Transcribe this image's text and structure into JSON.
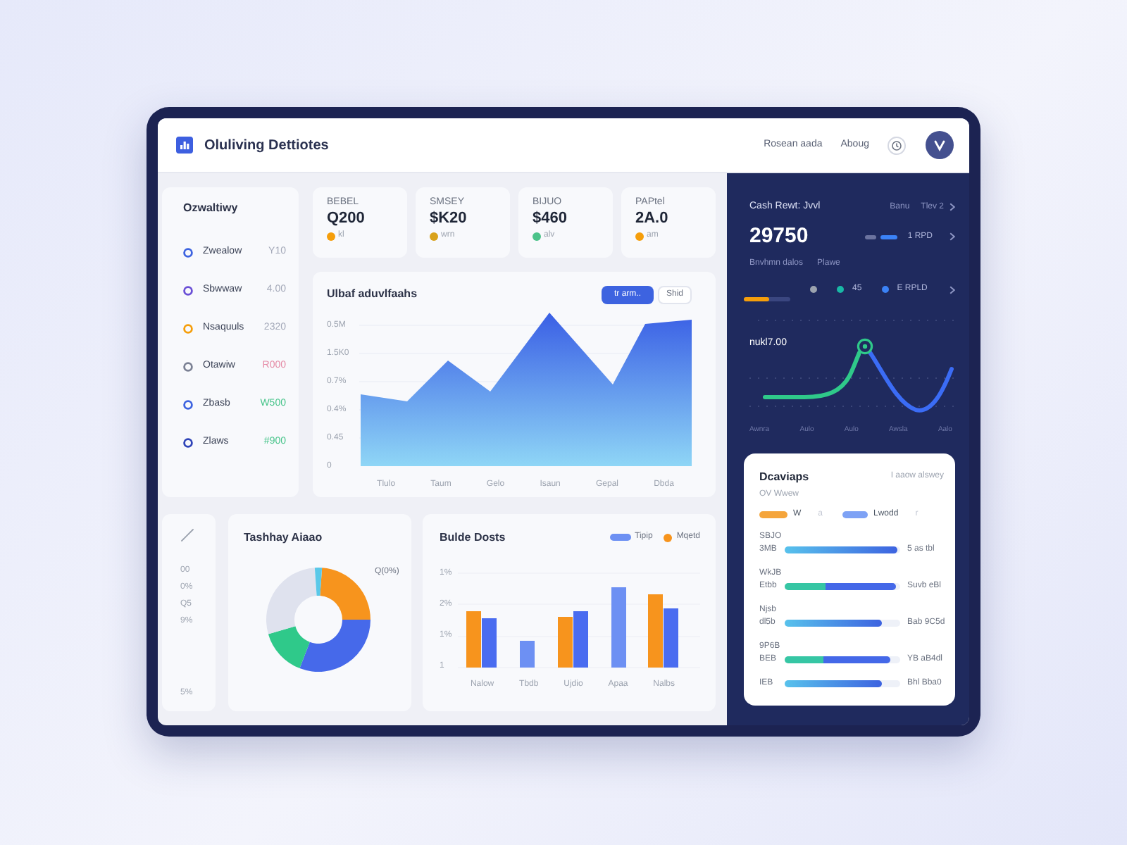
{
  "header": {
    "title": "Oluliving Dettiotes",
    "links": [
      "Rosean aada",
      "Aboug"
    ]
  },
  "sidebar": {
    "title": "Ozwaltiwy",
    "items": [
      {
        "label": "Zwealow",
        "value": "Y10",
        "color": "#3d63e0",
        "kind": "neutral"
      },
      {
        "label": "Sbwwaw",
        "value": "4.00",
        "color": "#6a4fd6",
        "kind": "neutral"
      },
      {
        "label": "Nsaquuls",
        "value": "2320",
        "color": "#f59e0b",
        "kind": "neutral"
      },
      {
        "label": "Otawiw",
        "value": "R000",
        "color": "#7b8194",
        "kind": "down"
      },
      {
        "label": "Zbasb",
        "value": "W500",
        "color": "#3d63e0",
        "kind": "up"
      },
      {
        "label": "Zlaws",
        "value": "#900",
        "color": "#2f44b8",
        "kind": "up"
      }
    ]
  },
  "stats": [
    {
      "label": "BEBEL",
      "value": "Q200",
      "change": "kl",
      "color": "#f59e0b"
    },
    {
      "label": "SMSEY",
      "value": "$K20",
      "change": "wrn",
      "color": "#d9a21b"
    },
    {
      "label": "BIJUO",
      "value": "$460",
      "change": "alv",
      "color": "#4cc38a"
    },
    {
      "label": "PAPtel",
      "value": "2A.0",
      "change": "am",
      "color": "#f59e0b"
    }
  ],
  "area_chart": {
    "title": "Ulbaf aduvlfaahs",
    "buttons": [
      {
        "label": "tr arm..",
        "selected": true
      },
      {
        "label": "Shid",
        "selected": false
      }
    ],
    "y_labels": [
      "0.5M",
      "1.5K0",
      "0.7%",
      "0.4%",
      "0.45",
      "0"
    ],
    "x_labels": [
      "Tlulo",
      "Taum",
      "Gelo",
      "Isaun",
      "Gepal",
      "Dbda"
    ]
  },
  "summary": {
    "title": "Cash Rewt: Jvvl",
    "links": [
      "Banu",
      "Tlev 2"
    ],
    "total": "29750",
    "series_label": "1 RPD",
    "captions": [
      "Bnvhmn dalos",
      "Plawe"
    ],
    "progress": {
      "level": 0.55
    },
    "indicators": [
      {
        "color": "#9ca3af"
      },
      {
        "color": "#19b8a6",
        "label": "45"
      },
      {
        "color": "#3b82f6",
        "label": "E RPLD"
      }
    ],
    "chart_label": "nukl7.00",
    "x_labels": [
      "Awnra",
      "Aulo",
      "Aulo",
      "Awsla",
      "Aalo"
    ]
  },
  "axis_panel": {
    "labels": [
      "00",
      "0%",
      "Q5",
      "9%"
    ],
    "footer": "5%"
  },
  "donut_chart": {
    "title": "Tashhay Aiaao",
    "label": "Q(0%)"
  },
  "bar_chart": {
    "title": "Bulde Dosts",
    "legend": [
      {
        "kind": "pill",
        "label": "Tipip",
        "color": "#6d90f3"
      },
      {
        "kind": "dot",
        "label": "Mqetd",
        "color": "#f7941d"
      }
    ],
    "y_labels": [
      "1%",
      "2%",
      "1%",
      "1"
    ],
    "x_labels": [
      "Nalow",
      "Tbdb",
      "Ujdio",
      "Apaa",
      "Nalbs"
    ]
  },
  "distribution": {
    "title": "Dcaviaps",
    "note": "I aaow alswey",
    "subtitle": "OV Wwew",
    "legend": [
      {
        "label": "W",
        "color": "#f5a53b",
        "note": "a"
      },
      {
        "label": "Lwodd",
        "color": "#7ea2f5",
        "note": "r"
      }
    ],
    "rows": [
      {
        "labels": [
          "SBJO",
          "3MB"
        ],
        "kind": "gradient",
        "level": 0.98,
        "value": "5 as tbl"
      },
      {
        "labels": [
          "WkJB",
          "Etbb"
        ],
        "kind": "split",
        "level": 0.96,
        "value": "Suvb eBl"
      },
      {
        "labels": [
          "Njsb",
          "dl5b"
        ],
        "kind": "gradient",
        "level": 0.84,
        "value": "Bab 9C5d"
      },
      {
        "labels": [
          "9P6B",
          "BEB"
        ],
        "kind": "split",
        "level": 0.91,
        "value": "YB aB4dl"
      },
      {
        "labels": [
          "IEB"
        ],
        "kind": "gradient",
        "level": 0.84,
        "value": "Bhl Bba0"
      }
    ]
  }
}
